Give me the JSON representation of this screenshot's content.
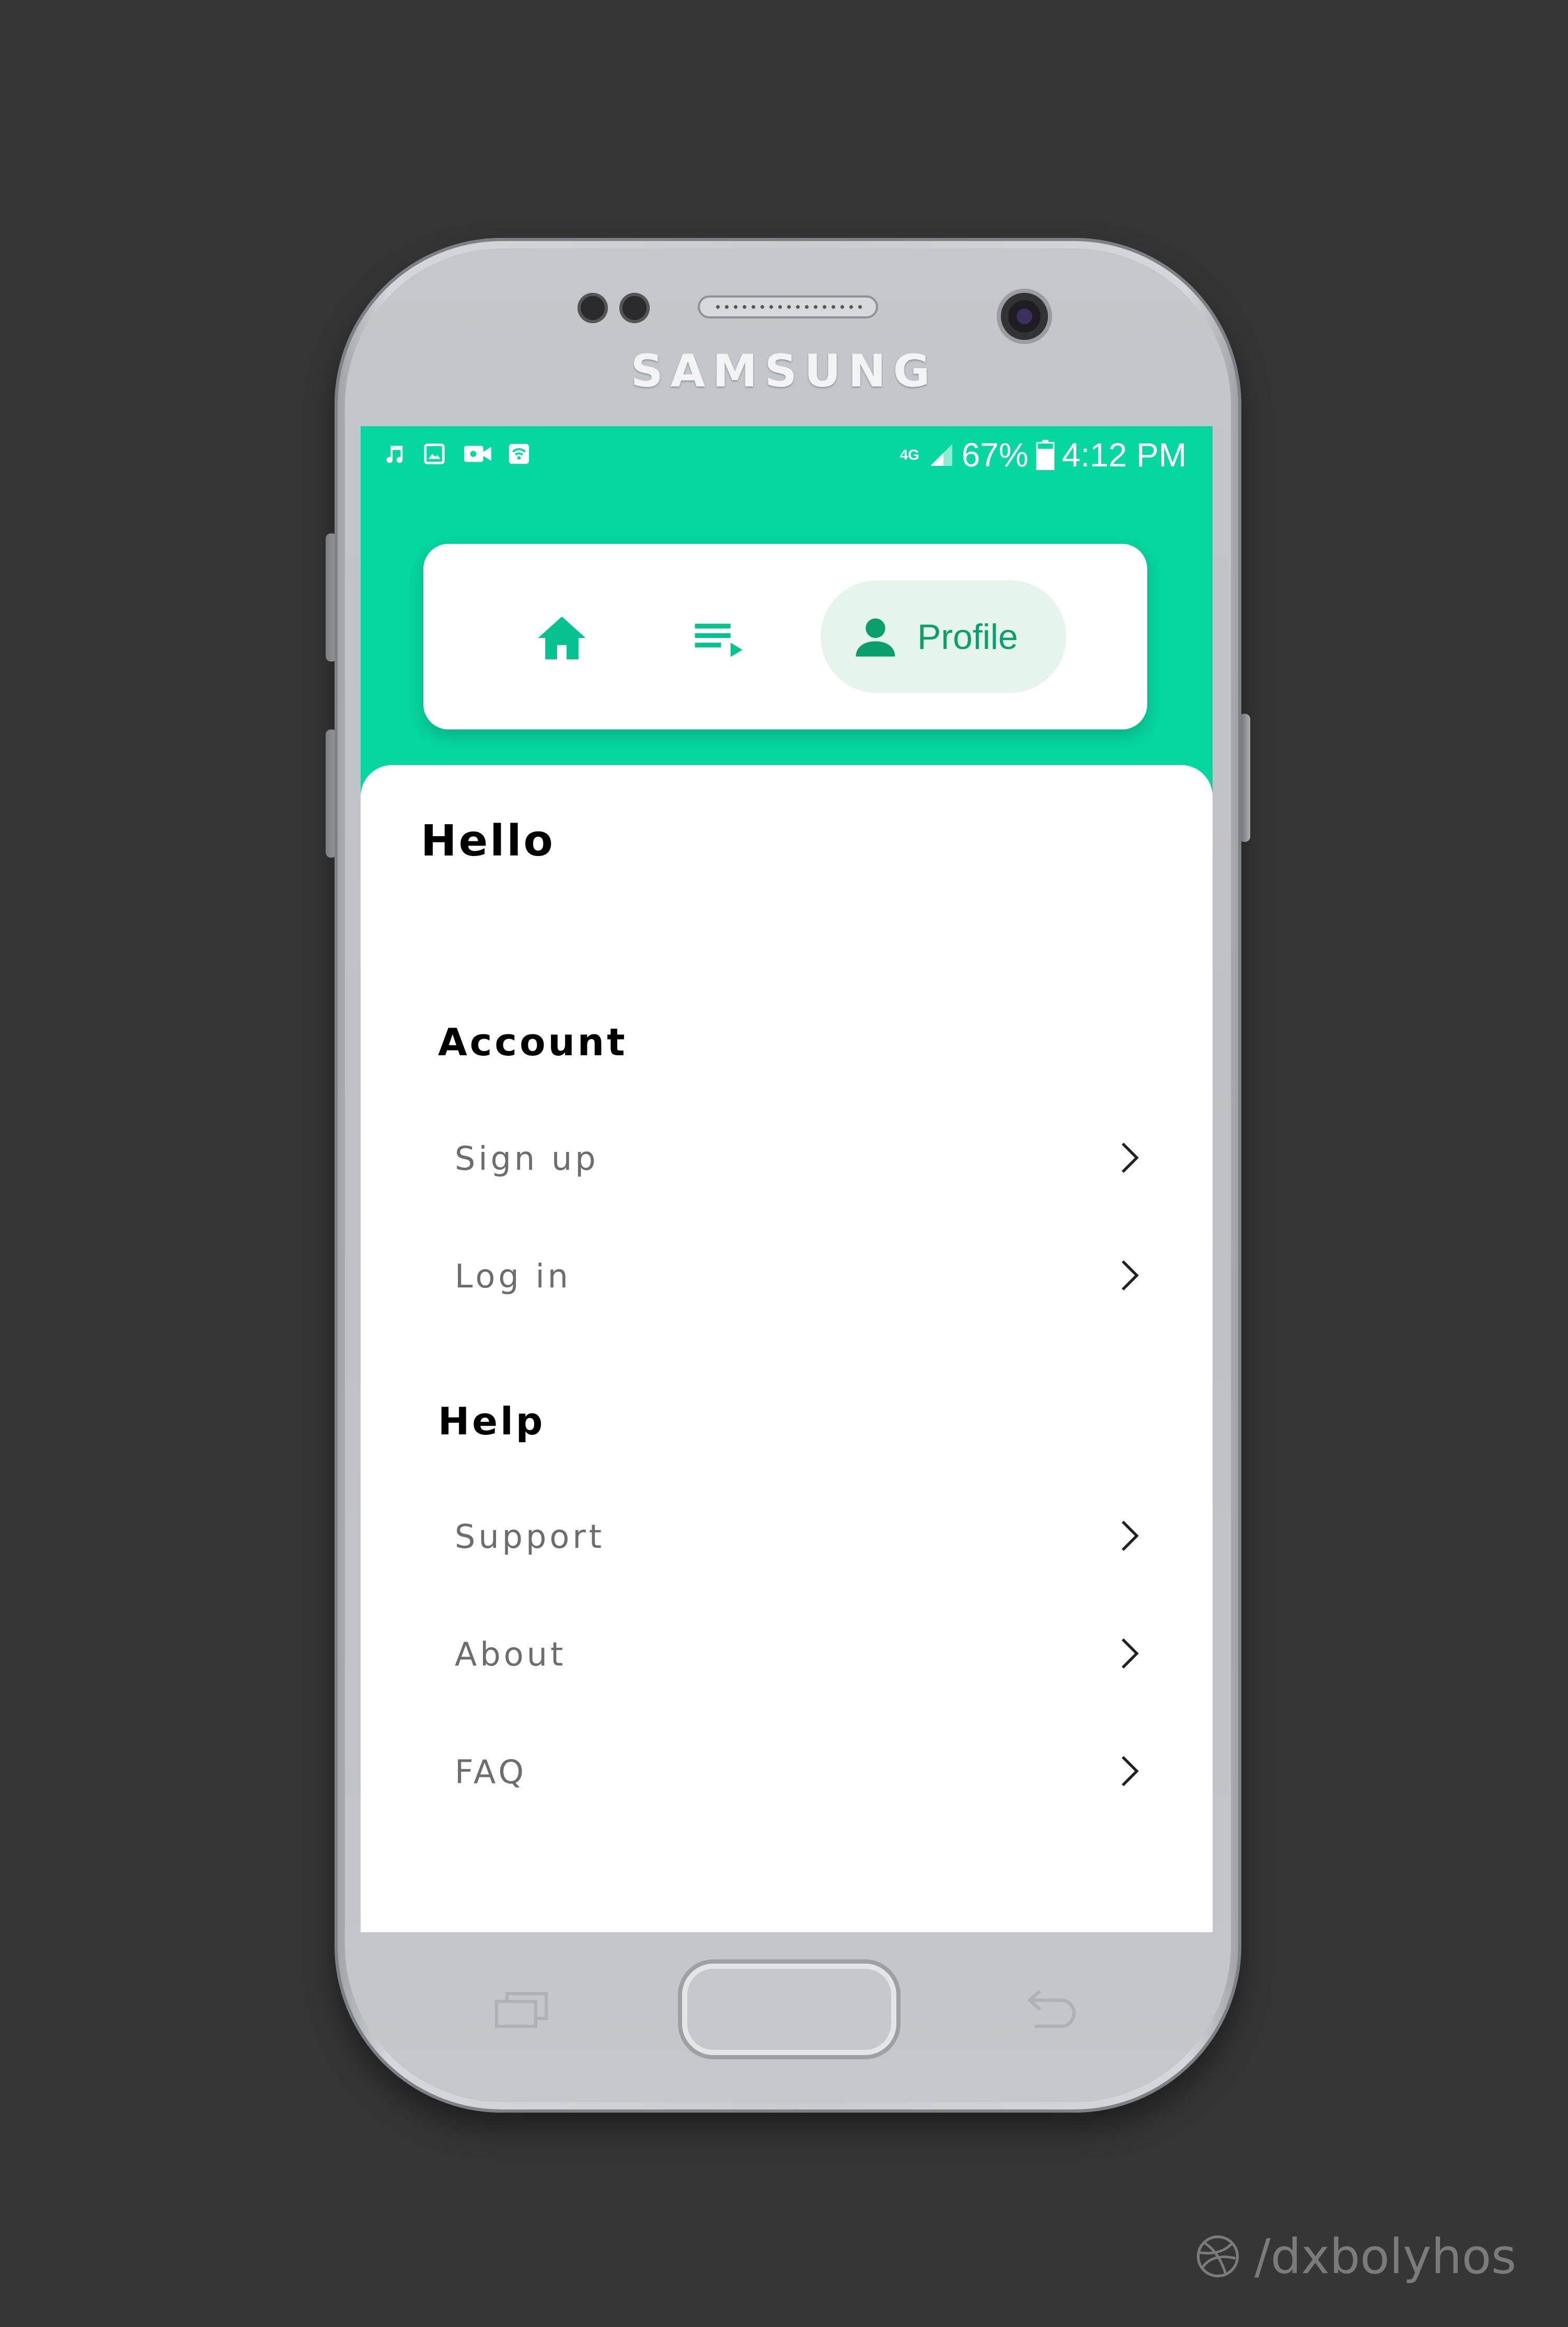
{
  "device": {
    "brand": "SAMSUNG"
  },
  "status_bar": {
    "left_icons": [
      "music-note-icon",
      "image-icon",
      "video-camera-icon",
      "wifi-hotspot-icon"
    ],
    "network": "4G",
    "battery_percent": "67%",
    "time": "4:12 PM"
  },
  "nav": {
    "items": [
      {
        "icon": "home-icon",
        "label": ""
      },
      {
        "icon": "playlist-icon",
        "label": ""
      },
      {
        "icon": "person-icon",
        "label": "Profile",
        "active": true
      }
    ]
  },
  "content": {
    "greeting": "Hello",
    "sections": [
      {
        "title": "Account",
        "items": [
          "Sign up",
          "Log in"
        ]
      },
      {
        "title": "Help",
        "items": [
          "Support",
          "About",
          "FAQ"
        ]
      }
    ]
  },
  "watermark": "/dxbolyhos",
  "colors": {
    "accent": "#06d6a0",
    "active_pill": "#e6f5ec",
    "active_text": "#0b9f6e",
    "background": "#363636"
  }
}
